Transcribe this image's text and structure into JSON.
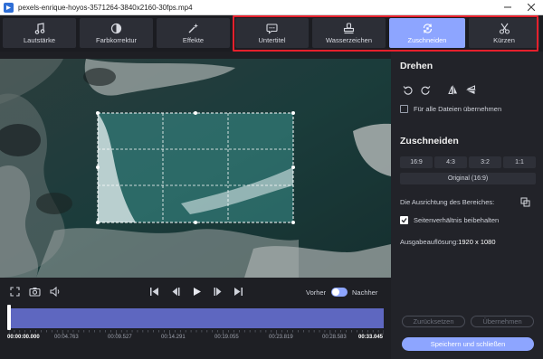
{
  "window": {
    "title": "pexels-enrique-hoyos-3571264-3840x2160-30fps.mp4"
  },
  "tabs": [
    {
      "label": "Lautstärke",
      "icon": "music-note-icon"
    },
    {
      "label": "Farbkorrektur",
      "icon": "color-correction-icon"
    },
    {
      "label": "Effekte",
      "icon": "magic-wand-icon"
    },
    {
      "label": "Untertitel",
      "icon": "subtitle-bubble-icon"
    },
    {
      "label": "Wasserzeichen",
      "icon": "watermark-stamp-icon"
    },
    {
      "label": "Zuschneiden",
      "icon": "crop-rotate-icon",
      "active": true
    },
    {
      "label": "Kürzen",
      "icon": "scissors-icon"
    }
  ],
  "rotate_section": {
    "title": "Drehen",
    "apply_all_label": "Für alle Dateien übernehmen",
    "apply_all_checked": false
  },
  "crop_section": {
    "title": "Zuschneiden",
    "ratios": [
      "16:9",
      "4:3",
      "3:2",
      "1:1"
    ],
    "original_label": "Original (16:9)",
    "alignment_label": "Die Ausrichtung des Bereiches:",
    "keep_ratio_label": "Seitenverhältnis beibehalten",
    "keep_ratio_checked": true,
    "resolution_label": "Ausgabeauflösung:",
    "resolution_value": "1920 x 1080"
  },
  "buttons": {
    "reset": "Zurücksetzen",
    "apply": "Übernehmen",
    "save_close": "Speichern und schließen"
  },
  "playback": {
    "before_label": "Vorher",
    "after_label": "Nachher"
  },
  "timeline": {
    "current": "00:00:00.000",
    "marks": [
      "00:04.763",
      "00:09.527",
      "00:14.291",
      "00:19.055",
      "00:23.819",
      "00:28.583"
    ],
    "end": "00:33.045"
  },
  "colors": {
    "accent": "#8da5ff",
    "highlight_border": "#e5202c",
    "panel": "#222329",
    "track": "#6b74c7"
  }
}
